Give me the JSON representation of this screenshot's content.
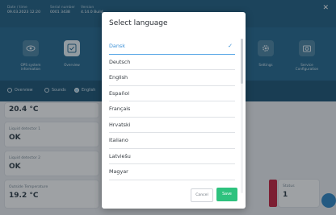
{
  "header": {
    "fields": [
      {
        "label": "Date / time",
        "value": "09.03.2023 12:20"
      },
      {
        "label": "Serial number",
        "value": "0001 3438"
      },
      {
        "label": "Version",
        "value": "4.14.0 Build"
      }
    ]
  },
  "tiles": [
    {
      "label": "OPS system\ninformation",
      "icon": "eye-icon"
    },
    {
      "label": "Overview",
      "icon": "checklist-icon"
    },
    {
      "label": "Settings",
      "icon": "gear-icon"
    },
    {
      "label": "Service\nConfiguration",
      "icon": "camera-icon"
    }
  ],
  "filters": [
    {
      "label": "Overview",
      "selected": false
    },
    {
      "label": "Sounds",
      "selected": false
    },
    {
      "label": "English",
      "selected": true
    }
  ],
  "cards": [
    {
      "label": "",
      "value": "20.4 °C"
    },
    {
      "label": "Liquid detector 1",
      "value": "OK"
    },
    {
      "label": "Liquid detector 2",
      "value": "OK"
    },
    {
      "label": "Outside Temperature",
      "value": "19.2 °C"
    },
    {
      "label": "Status",
      "value": "1"
    }
  ],
  "modal": {
    "title": "Select language",
    "selected": "Dansk",
    "languages": [
      "Dansk",
      "Deutsch",
      "English",
      "Español",
      "Français",
      "Hrvatski",
      "Italiano",
      "Latviešu",
      "Magyar"
    ],
    "cancel_label": "Cancel",
    "save_label": "Save"
  },
  "colors": {
    "accent": "#3a8fd6",
    "save": "#2ec27e",
    "header": "#1f5f83",
    "status_red": "#c4203d"
  }
}
